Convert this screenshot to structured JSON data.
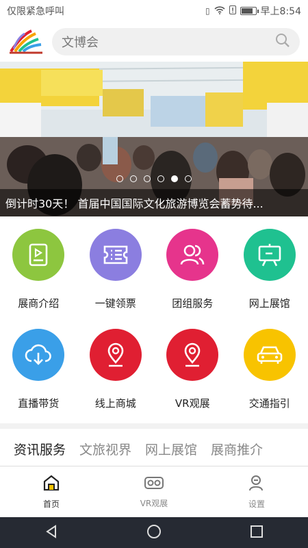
{
  "status": {
    "left": "仅限紧急呼叫",
    "time": "早上8:54",
    "battery_level": 0.85
  },
  "search": {
    "placeholder": "文博会"
  },
  "banner": {
    "caption": "倒计时30天！ 首届中国国际文化旅游博览会蓄势待...",
    "slide_count": 6,
    "active_slide": 4
  },
  "grid": [
    {
      "label": "展商介绍",
      "color": "#8dc63f",
      "icon": "play-document-icon"
    },
    {
      "label": "一键领票",
      "color": "#8b7ee0",
      "icon": "ticket-icon"
    },
    {
      "label": "团组服务",
      "color": "#e6348c",
      "icon": "group-icon"
    },
    {
      "label": "网上展馆",
      "color": "#1fc190",
      "icon": "easel-icon"
    },
    {
      "label": "直播带货",
      "color": "#3a9fe8",
      "icon": "cloud-download-icon"
    },
    {
      "label": "线上商城",
      "color": "#e01f32",
      "icon": "location-pin-icon"
    },
    {
      "label": "VR观展",
      "color": "#e01f32",
      "icon": "location-pin-icon"
    },
    {
      "label": "交通指引",
      "color": "#f8c300",
      "icon": "car-icon"
    }
  ],
  "tabs": [
    "资讯服务",
    "文旅视界",
    "网上展馆",
    "展商推介"
  ],
  "active_tab": 0,
  "bottom_nav": [
    {
      "label": "首页",
      "icon": "home-icon"
    },
    {
      "label": "VR观展",
      "icon": "vr-headset-icon"
    },
    {
      "label": "设置",
      "icon": "user-settings-icon"
    }
  ],
  "accent": "#2a8ad6"
}
